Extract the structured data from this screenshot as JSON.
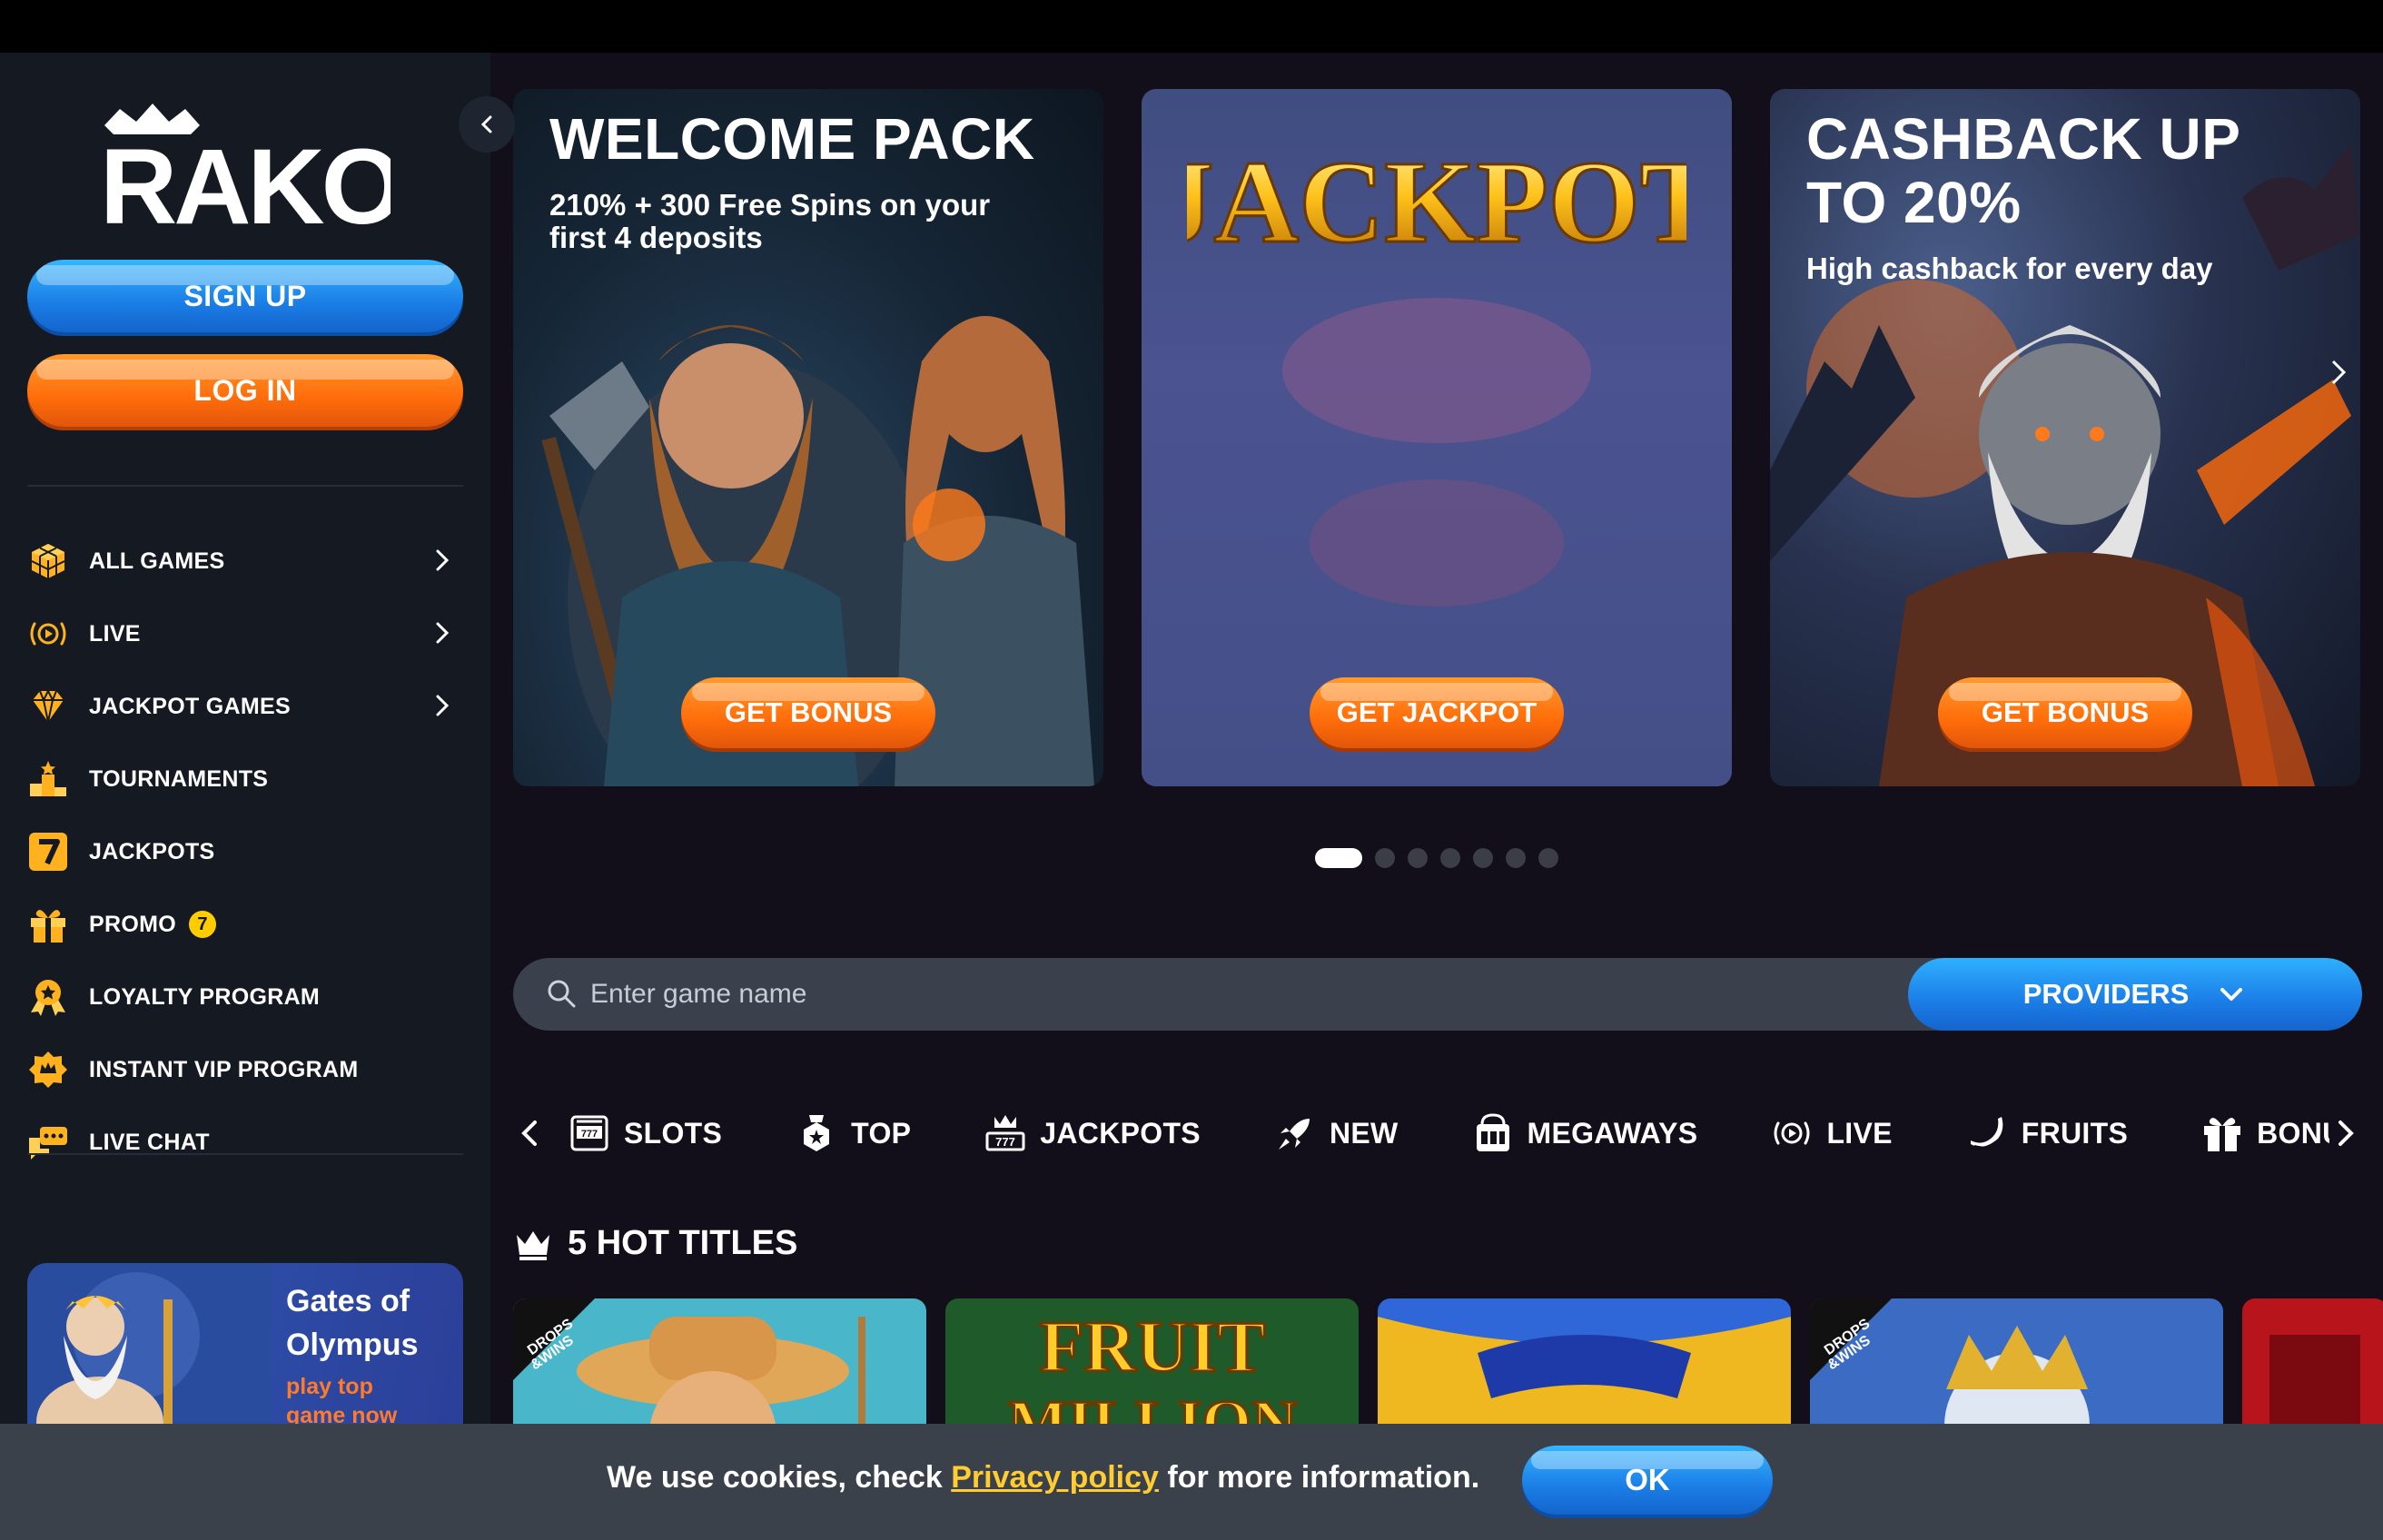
{
  "brand": {
    "name": "RAKOO",
    "accent_blue": "#1b7de6",
    "accent_orange": "#ff6d0a",
    "accent_yellow": "#ffcc33"
  },
  "auth": {
    "signup_label": "SIGN UP",
    "login_label": "LOG IN"
  },
  "sidebar": {
    "items": [
      {
        "label": "ALL GAMES",
        "icon": "cube-icon",
        "has_chevron": true
      },
      {
        "label": "LIVE",
        "icon": "live-broadcast-icon",
        "has_chevron": true
      },
      {
        "label": "JACKPOT GAMES",
        "icon": "diamond-icon",
        "has_chevron": true
      },
      {
        "label": "TOURNAMENTS",
        "icon": "podium-icon",
        "has_chevron": false
      },
      {
        "label": "JACKPOTS",
        "icon": "seven-icon",
        "has_chevron": false
      },
      {
        "label": "PROMO",
        "icon": "gift-icon",
        "has_chevron": false,
        "badge": "7"
      },
      {
        "label": "LOYALTY PROGRAM",
        "icon": "medal-icon",
        "has_chevron": false
      },
      {
        "label": "INSTANT VIP PROGRAM",
        "icon": "vip-badge-icon",
        "has_chevron": false
      },
      {
        "label": "LIVE CHAT",
        "icon": "chat-icon",
        "has_chevron": false
      }
    ],
    "promo_card": {
      "title_line1": "Gates of",
      "title_line2": "Olympus",
      "sub_line1": "play top",
      "sub_line2": "game now"
    }
  },
  "banners": [
    {
      "title": "WELCOME PACK",
      "subtitle_line1": "210% + 300 Free Spins on your",
      "subtitle_line2": "first 4 deposits",
      "cta": "GET BONUS"
    },
    {
      "title": "JACKPOT",
      "cta": "GET JACKPOT"
    },
    {
      "title_line1": "CASHBACK UP",
      "title_line2": "TO 20%",
      "subtitle": "High cashback for every day",
      "cta": "GET BONUS"
    }
  ],
  "carousel": {
    "total_slides": 7,
    "active_index": 0
  },
  "search": {
    "placeholder": "Enter game name",
    "providers_label": "PROVIDERS"
  },
  "categories": [
    {
      "label": "SLOTS",
      "icon": "slot-machine-icon"
    },
    {
      "label": "TOP",
      "icon": "top-badge-icon"
    },
    {
      "label": "JACKPOTS",
      "icon": "jackpot-777-icon"
    },
    {
      "label": "NEW",
      "icon": "rocket-icon"
    },
    {
      "label": "MEGAWAYS",
      "icon": "megaways-icon"
    },
    {
      "label": "LIVE",
      "icon": "live-broadcast-icon"
    },
    {
      "label": "FRUITS",
      "icon": "banana-icon"
    },
    {
      "label": "BONUS",
      "icon": "gift-icon"
    }
  ],
  "hot_section": {
    "title": "5 HOT TITLES"
  },
  "game_tiles": [
    {
      "name": "cowboy-game",
      "badge": "DROPS & WINS"
    },
    {
      "name": "fruit-million",
      "text": "FRUIT MILLION"
    },
    {
      "name": "gold-game"
    },
    {
      "name": "zeus-game",
      "badge": "DROPS & WINS"
    },
    {
      "name": "red-game"
    }
  ],
  "cookie": {
    "text_before": "We use cookies, check ",
    "link": "Privacy policy",
    "text_after": " for more information.",
    "ok_label": "OK"
  }
}
